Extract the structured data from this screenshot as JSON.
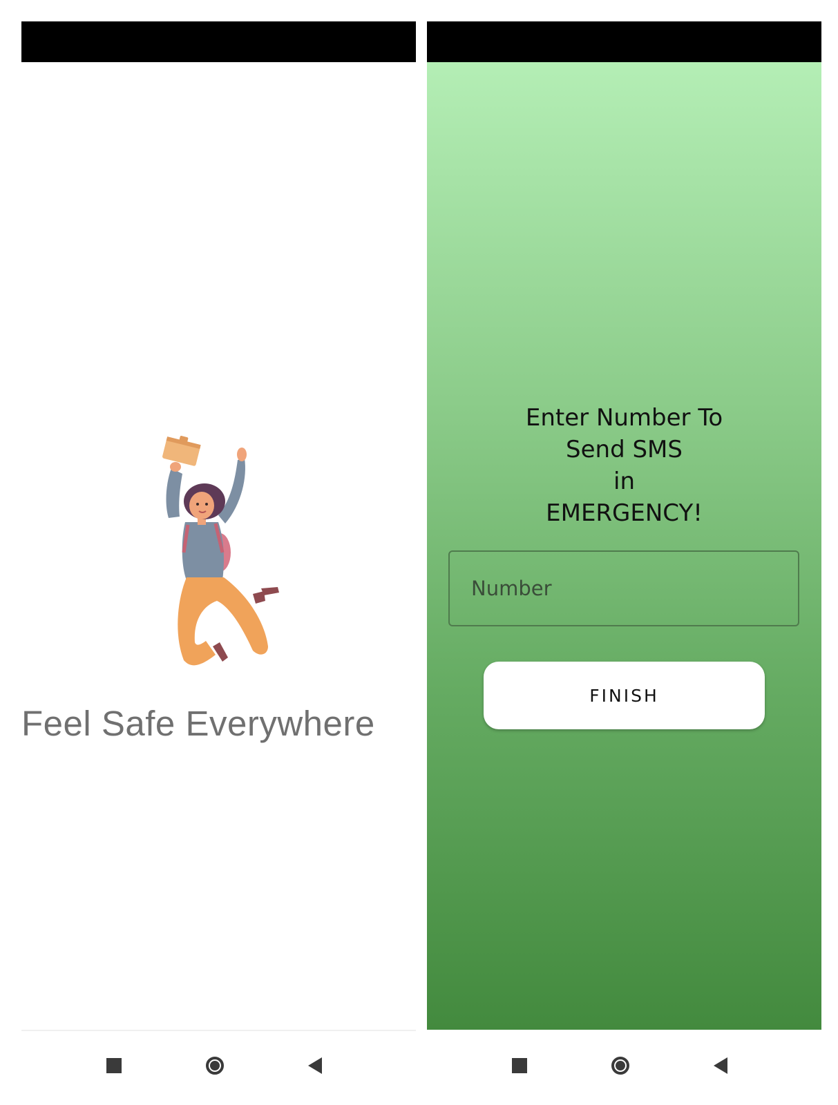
{
  "left_screen": {
    "tagline": "Feel Safe Everywhere",
    "illustration": "jumping-girl-illustration",
    "nav": {
      "recent_icon": "square-icon",
      "home_icon": "circle-home-icon",
      "back_icon": "triangle-back-icon"
    }
  },
  "right_screen": {
    "prompt_lines": [
      "Enter Number To",
      "Send SMS",
      "in",
      "EMERGENCY!"
    ],
    "number_field": {
      "placeholder": "Number",
      "value": ""
    },
    "finish_label": "FINISH",
    "nav": {
      "recent_icon": "square-icon",
      "home_icon": "circle-home-icon",
      "back_icon": "triangle-back-icon"
    }
  },
  "colors": {
    "gradient_top": "#b4eeb5",
    "gradient_bottom": "#438a3e",
    "tagline_text": "#707070",
    "status_bar": "#000000"
  }
}
